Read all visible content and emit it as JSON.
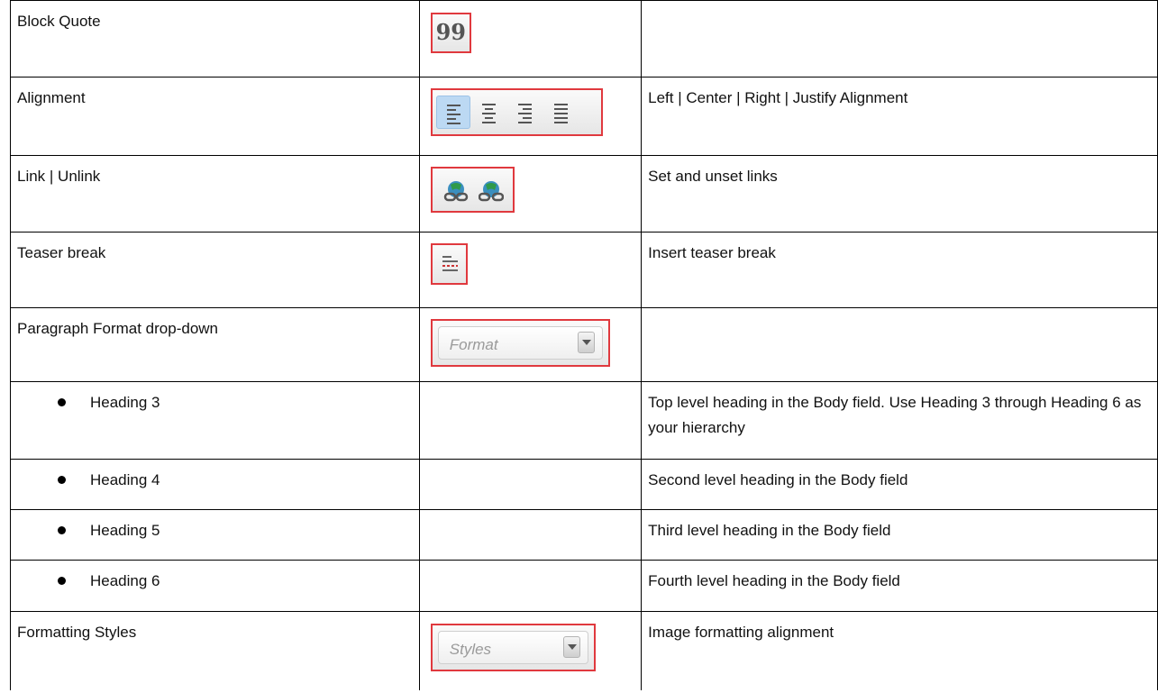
{
  "rows": [
    {
      "label": "Block Quote",
      "description": "",
      "toolbar": "block-quote",
      "icon_glyph": "99"
    },
    {
      "label": "Alignment",
      "description": "Left | Center | Right | Justify Alignment",
      "toolbar": "alignment"
    },
    {
      "label": "Link | Unlink",
      "description": "Set and unset links",
      "toolbar": "link-unlink"
    },
    {
      "label": "Teaser break",
      "description": "Insert teaser break",
      "toolbar": "teaser-break"
    },
    {
      "label": "Paragraph Format drop-down",
      "description": "",
      "toolbar": "format-combo",
      "combo_label": "Format"
    },
    {
      "label": "Heading 3",
      "bullet": true,
      "description": "Top level heading in the Body field. Use Heading 3 through Heading 6 as your hierarchy"
    },
    {
      "label": "Heading 4",
      "bullet": true,
      "description": "Second level heading in the Body field"
    },
    {
      "label": "Heading 5",
      "bullet": true,
      "description": "Third level heading in the Body field"
    },
    {
      "label": "Heading 6",
      "bullet": true,
      "description": "Fourth level heading in the Body field"
    },
    {
      "label": "Formatting Styles",
      "description": "Image formatting alignment",
      "toolbar": "styles-combo",
      "combo_label": "Styles"
    }
  ],
  "colors": {
    "highlight_border": "#e0393e",
    "active_button": "#bcd9f3",
    "grid": "#000000"
  }
}
